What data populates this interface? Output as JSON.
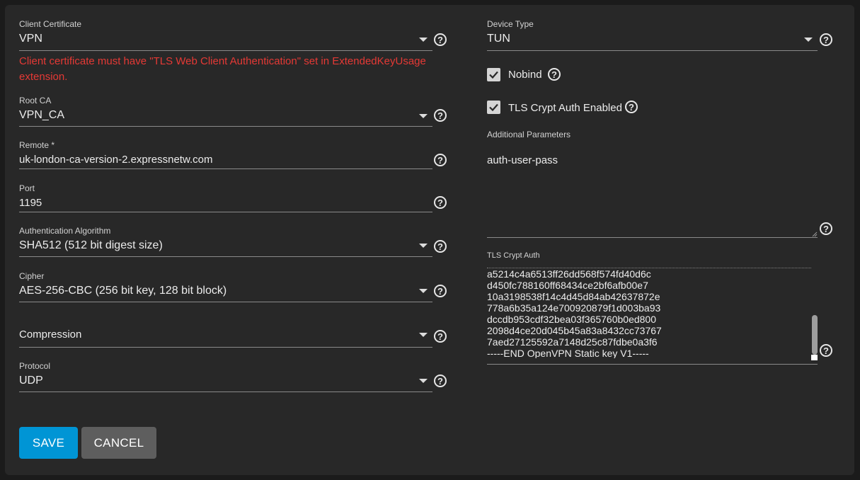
{
  "left": {
    "client_certificate": {
      "label": "Client Certificate",
      "value": "VPN"
    },
    "error": "Client certificate must have \"TLS Web Client Authentication\" set in ExtendedKeyUsage extension.",
    "root_ca": {
      "label": "Root CA",
      "value": "VPN_CA"
    },
    "remote": {
      "label": "Remote *",
      "value": "uk-london-ca-version-2.expressnetw.com"
    },
    "port": {
      "label": "Port",
      "value": "1195"
    },
    "auth_algorithm": {
      "label": "Authentication Algorithm",
      "value": "SHA512 (512 bit digest size)"
    },
    "cipher": {
      "label": "Cipher",
      "value": "AES-256-CBC (256 bit key, 128 bit block)"
    },
    "compression": {
      "placeholder": "Compression"
    },
    "protocol": {
      "label": "Protocol",
      "value": "UDP"
    }
  },
  "right": {
    "device_type": {
      "label": "Device Type",
      "value": "TUN"
    },
    "nobind": {
      "label": "Nobind",
      "checked": true
    },
    "tls_crypt_auth_enabled": {
      "label": "TLS Crypt Auth Enabled",
      "checked": true
    },
    "additional_parameters": {
      "label": "Additional Parameters",
      "value": "auth-user-pass"
    },
    "tls_crypt_auth": {
      "label": "TLS Crypt Auth",
      "lines": [
        "a5214c4a6513ff26dd568f574fd40d6c",
        "d450fc788160ff68434ce2bf6afb00e7",
        "10a3198538f14c4d45d84ab42637872e",
        "778a6b35a124e700920879f1d003ba93",
        "dccdb953cdf32bea03f365760b0ed800",
        "2098d4ce20d045b45a83a8432cc73767",
        "7aed27125592a7148d25c87fdbe0a3f6",
        "-----END OpenVPN Static key V1-----"
      ]
    }
  },
  "buttons": {
    "save": "SAVE",
    "cancel": "CANCEL"
  },
  "help_glyph": "?",
  "colors": {
    "accent": "#0095d5",
    "error": "#e53935",
    "card": "#282828",
    "background": "#1b1b1b"
  }
}
